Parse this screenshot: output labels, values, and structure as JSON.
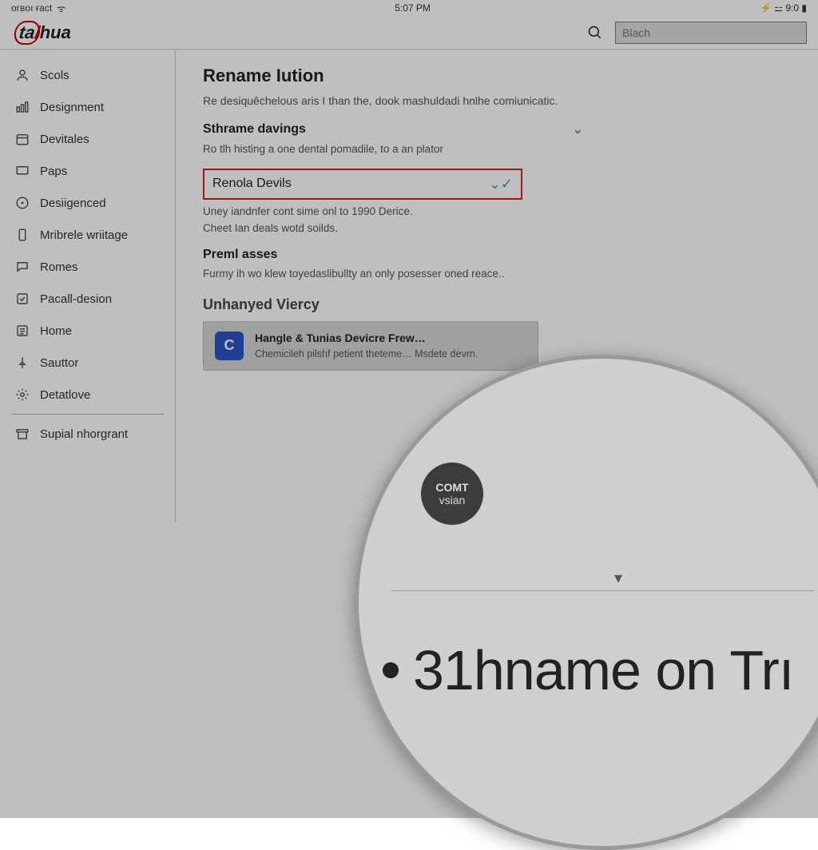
{
  "statusbar": {
    "carrier": "oгвoı ғact",
    "time": "5:07 PM",
    "indicators": "⚡ ⚍ 9:0 ▮"
  },
  "logo": {
    "pre": "ta",
    "slash": "/",
    "post": "hua"
  },
  "search": {
    "placeholder": "Blach"
  },
  "sidebar": {
    "items": [
      {
        "icon": "person",
        "label": "Scols"
      },
      {
        "icon": "chart",
        "label": "Designment"
      },
      {
        "icon": "calendar",
        "label": "Devitales"
      },
      {
        "icon": "screen",
        "label": "Paps"
      },
      {
        "icon": "compass",
        "label": "Desiigenced"
      },
      {
        "icon": "phone",
        "label": "Mribrele wriitage"
      },
      {
        "icon": "chat",
        "label": "Romes"
      },
      {
        "icon": "checkbox",
        "label": "Pacall-desion"
      },
      {
        "icon": "list",
        "label": "Home"
      },
      {
        "icon": "pin",
        "label": "Sauttor"
      },
      {
        "icon": "gear",
        "label": "Detatlove"
      },
      {
        "icon": "archive",
        "label": "Supial nhorgrant"
      }
    ]
  },
  "main": {
    "title": "Rename Iution",
    "desc": "Re desiquêchelous aris I than the, dook mashuldadi hnlhe comiunicatic.",
    "sections": [
      {
        "title": "Sthrame davings",
        "sub": "Ro tlh histing a one dental pomadile, to a an plator"
      },
      {
        "title": "Renolа Devils",
        "sub1": "Uney iandnfer cont sime onl to 1990 Derice.",
        "sub2": "Cheet Ian deals wotd soilds."
      },
      {
        "title": "Preml asses",
        "sub": "Furmy ih wo klew toyedaslibullty an only posesser oned reace.."
      }
    ],
    "list": {
      "heading": "Unhanyed Viercy",
      "item": {
        "thumb": "C",
        "title": "Hangle & Tunias Devicre Frew…",
        "desc": "Chemicileh pilshf petient theteme… Msdete devrn."
      }
    }
  },
  "magnifier": {
    "badge_l1": "COMT",
    "badge_l2": "vsian",
    "drop": "▾",
    "text": "31hname on Trı"
  },
  "colors": {
    "highlight": "#d62020",
    "accent": "#2a56c6"
  }
}
